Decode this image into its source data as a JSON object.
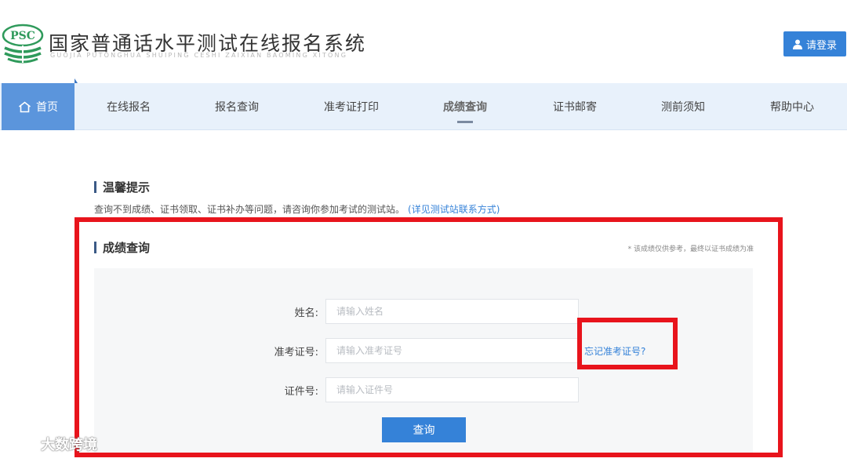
{
  "header": {
    "title": "国家普通话水平测试在线报名系统",
    "subtitle": "GUOJIA PUTONGHUA SHUIPING CESHI ZAIXIAN BAOMING XITONG",
    "logo_text": "PSC",
    "login_label": "请登录",
    "login_icon": "user-icon"
  },
  "nav": {
    "home_label": "首页",
    "home_icon": "home-icon",
    "items": [
      {
        "label": "在线报名"
      },
      {
        "label": "报名查询"
      },
      {
        "label": "准考证打印"
      },
      {
        "label": "成绩查询",
        "active": true
      },
      {
        "label": "证书邮寄"
      },
      {
        "label": "测前须知"
      },
      {
        "label": "帮助中心"
      }
    ]
  },
  "tips": {
    "title": "温馨提示",
    "text": "查询不到成绩、证书领取、证书补办等问题，请咨询你参加考试的测试站。",
    "link": "(详见测试站联系方式)"
  },
  "query": {
    "title": "成绩查询",
    "note": "* 该成绩仅供参考，最终以证书成绩为准",
    "fields": [
      {
        "label": "姓名:",
        "placeholder": "请输入姓名",
        "value": ""
      },
      {
        "label": "准考证号:",
        "placeholder": "请输入准考证号",
        "value": ""
      },
      {
        "label": "证件号:",
        "placeholder": "请输入证件号",
        "value": ""
      }
    ],
    "forgot_link": "忘记准考证号?",
    "submit_label": "查询"
  },
  "watermark": {
    "text": "大数跨境"
  },
  "colors": {
    "primary": "#3582d8",
    "nav_bg": "#e8f1fb",
    "home_bg": "#5b95dc",
    "annotation": "#e8141c",
    "logo_green": "#2f9a5b"
  }
}
